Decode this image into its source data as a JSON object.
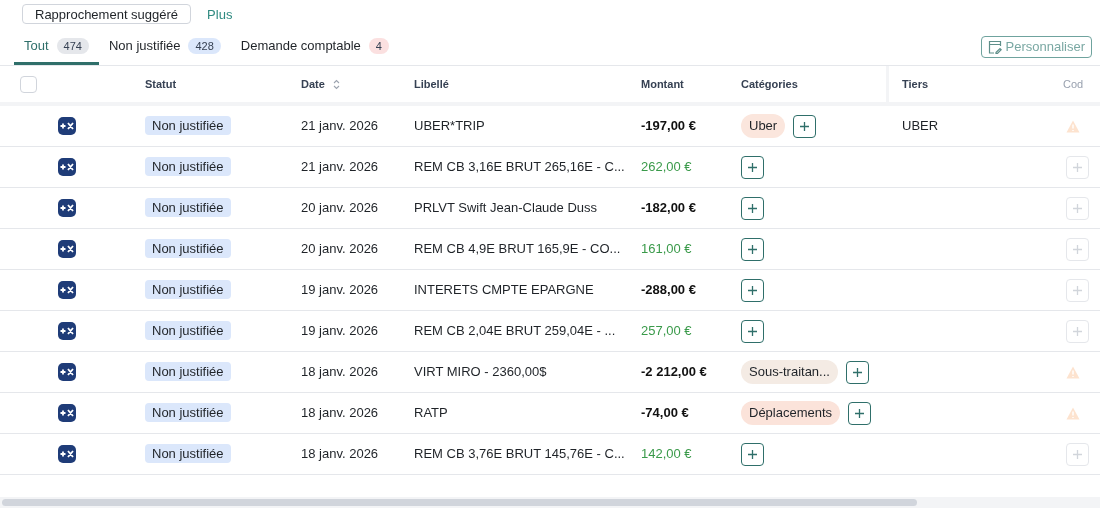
{
  "toolbar": {
    "buttons": [
      {
        "label": "Rapprochement suggéré",
        "kind": "outline"
      },
      {
        "label": "Plus",
        "kind": "link"
      }
    ]
  },
  "tabs": [
    {
      "label": "Tout",
      "count": "474",
      "color": "#e5e7eb",
      "selected": true
    },
    {
      "label": "Non justifiée",
      "count": "428",
      "color": "#dbe7fb",
      "selected": false
    },
    {
      "label": "Demande comptable",
      "count": "4",
      "color": "#fbe0e0",
      "selected": false
    }
  ],
  "customize_button": {
    "label": "Personnaliser"
  },
  "table": {
    "select_all": {
      "checked": false
    },
    "columns": [
      "Statut",
      "Date",
      "Libellé",
      "Montant",
      "Catégories",
      "Tiers",
      "Cod"
    ],
    "rows": [
      {
        "status": "Non justifiée",
        "date": "21 janv. 2026",
        "label": "UBER*TRIP",
        "amount": {
          "value": "-197,00 €",
          "kind": "debit"
        },
        "categories": [
          {
            "label": "Uber",
            "color": "#fbe6dd"
          }
        ],
        "third_party": "UBER",
        "code": {
          "kind": "warning"
        }
      },
      {
        "status": "Non justifiée",
        "date": "21 janv. 2026",
        "label": "REM CB 3,16E BRUT 265,16E - C...",
        "amount": {
          "value": "262,00 €",
          "kind": "credit"
        },
        "categories": [],
        "code": {
          "kind": "add"
        }
      },
      {
        "status": "Non justifiée",
        "date": "20 janv. 2026",
        "label": "PRLVT Swift Jean-Claude Duss",
        "amount": {
          "value": "-182,00 €",
          "kind": "debit"
        },
        "categories": [],
        "code": {
          "kind": "add"
        }
      },
      {
        "status": "Non justifiée",
        "date": "20 janv. 2026",
        "label": "REM CB 4,9E BRUT 165,9E - CO...",
        "amount": {
          "value": "161,00 €",
          "kind": "credit"
        },
        "categories": [],
        "code": {
          "kind": "add"
        }
      },
      {
        "status": "Non justifiée",
        "date": "19 janv. 2026",
        "label": "INTERETS CMPTE EPARGNE",
        "amount": {
          "value": "-288,00 €",
          "kind": "debit"
        },
        "categories": [],
        "code": {
          "kind": "add"
        }
      },
      {
        "status": "Non justifiée",
        "date": "19 janv. 2026",
        "label": "REM CB 2,04E BRUT 259,04E - ...",
        "amount": {
          "value": "257,00 €",
          "kind": "credit"
        },
        "categories": [],
        "code": {
          "kind": "add"
        }
      },
      {
        "status": "Non justifiée",
        "date": "18 janv. 2026",
        "label": "VIRT MIRO - 2360,00$",
        "amount": {
          "value": "-2 212,00 €",
          "kind": "debit"
        },
        "categories": [
          {
            "label": "Sous-traitan...",
            "color": "#f4ebe4"
          }
        ],
        "code": {
          "kind": "warning"
        }
      },
      {
        "status": "Non justifiée",
        "date": "18 janv. 2026",
        "label": "RATP",
        "amount": {
          "value": "-74,00 €",
          "kind": "debit"
        },
        "categories": [
          {
            "label": "Déplacements",
            "color": "#fbe3da"
          }
        ],
        "code": {
          "kind": "warning"
        }
      },
      {
        "status": "Non justifiée",
        "date": "18 janv. 2026",
        "label": "REM CB 3,76E BRUT 145,76E - C...",
        "amount": {
          "value": "142,00 €",
          "kind": "credit"
        },
        "categories": [],
        "code": {
          "kind": "add"
        }
      }
    ]
  }
}
